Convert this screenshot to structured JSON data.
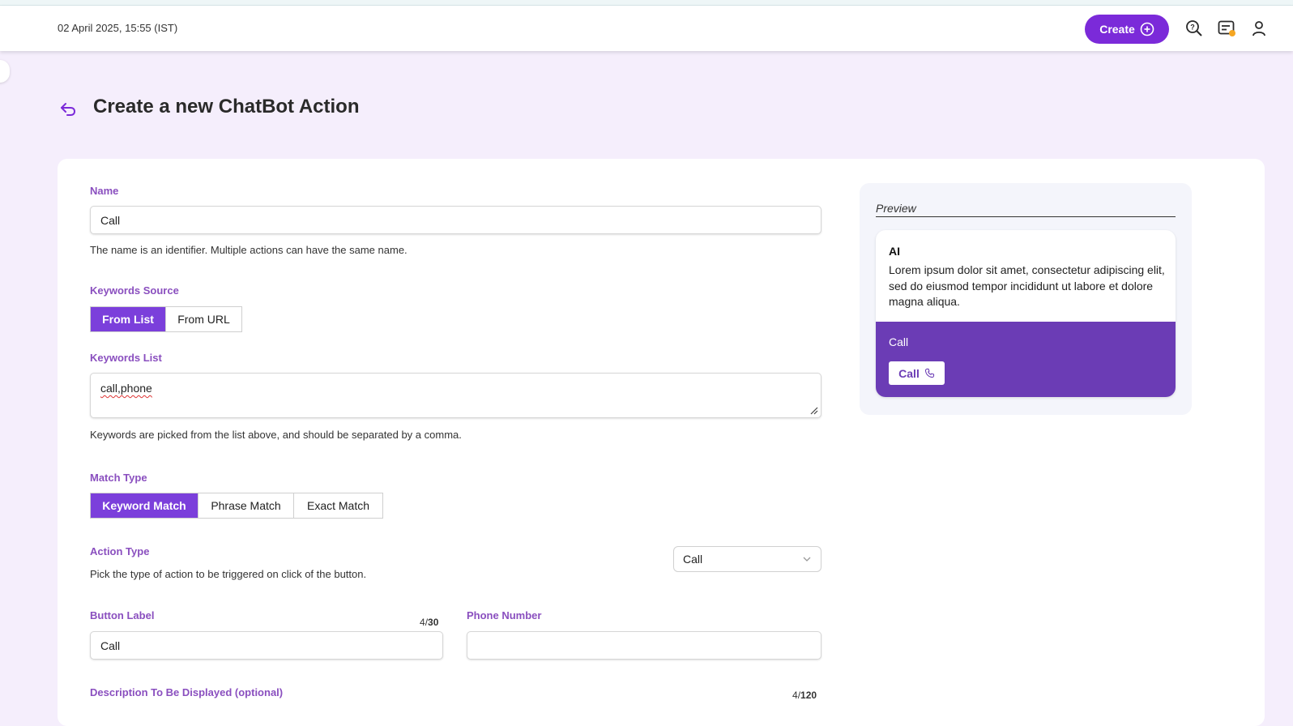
{
  "header": {
    "datetime": "02 April 2025, 15:55 (IST)",
    "create_label": "Create"
  },
  "page": {
    "title": "Create a new ChatBot Action"
  },
  "form": {
    "name": {
      "label": "Name",
      "value": "Call",
      "help": "The name is an identifier. Multiple actions can have the same name."
    },
    "keywords_source": {
      "label": "Keywords Source",
      "options": [
        "From List",
        "From URL"
      ],
      "selected": "From List"
    },
    "keywords_list": {
      "label": "Keywords List",
      "value": "call,phone",
      "help": "Keywords are picked from the list above, and should be separated by a comma."
    },
    "match_type": {
      "label": "Match Type",
      "options": [
        "Keyword Match",
        "Phrase Match",
        "Exact Match"
      ],
      "selected": "Keyword Match"
    },
    "action_type": {
      "label": "Action Type",
      "help": "Pick the type of action to be triggered on click of the button.",
      "value": "Call"
    },
    "button_label": {
      "label": "Button Label",
      "value": "Call",
      "count": "4",
      "max": "30"
    },
    "phone_number": {
      "label": "Phone Number",
      "value": ""
    },
    "description": {
      "label": "Description To Be Displayed (optional)",
      "count": "4",
      "max": "120"
    }
  },
  "preview": {
    "title": "Preview",
    "sender": "AI",
    "message": "Lorem ipsum dolor sit amet, consectetur adipiscing elit, sed do eiusmod tempor incididunt ut labore et dolore magna aliqua.",
    "footer_label": "Call",
    "button_label": "Call"
  },
  "colors": {
    "brand": "#7b2ad9",
    "label": "#8a4fbf",
    "preview_footer": "#6b3cb5",
    "background": "#f5eefc"
  }
}
